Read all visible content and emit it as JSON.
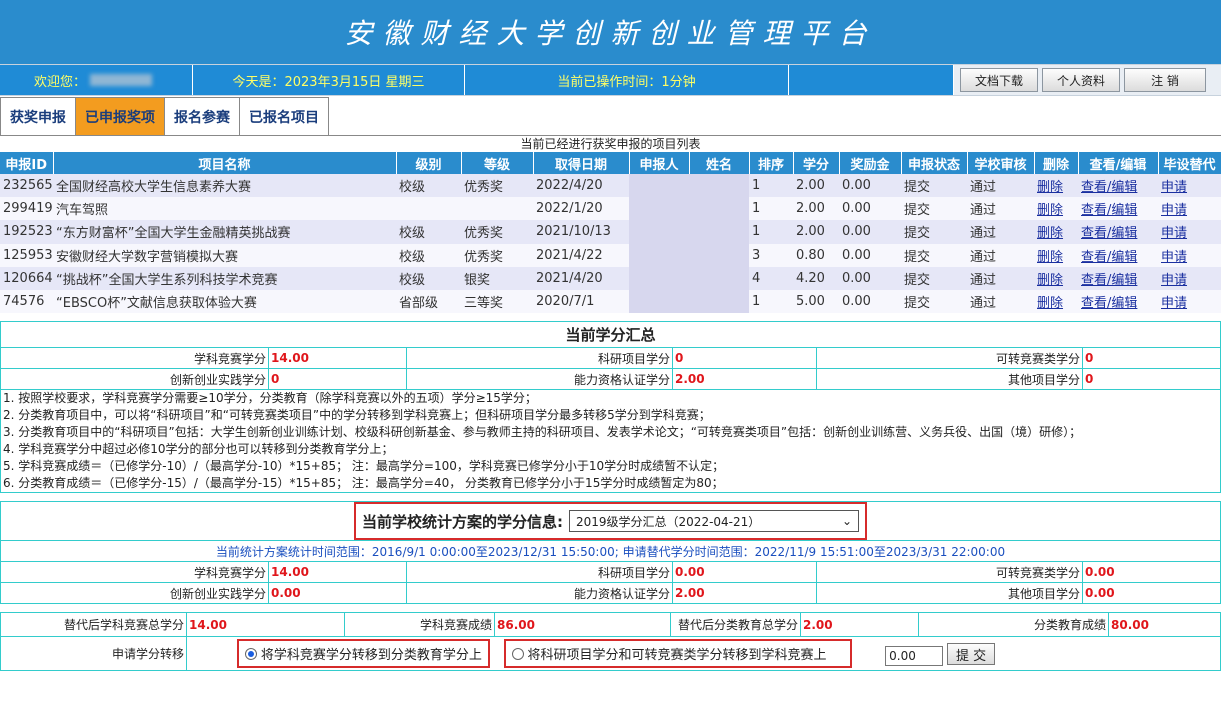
{
  "header": {
    "title": "安徽财经大学创新创业管理平台"
  },
  "infobar": {
    "welcome": "欢迎您：",
    "today": "今天是：2023年3月15日 星期三",
    "elapsed": "当前已操作时间：1分钟",
    "buttons": {
      "download": "文档下载",
      "profile": "个人资料",
      "logout": "注 销"
    }
  },
  "tabs": [
    "获奖申报",
    "已申报奖项",
    "报名参赛",
    "已报名项目"
  ],
  "award_table": {
    "caption": "当前已经进行获奖申报的项目列表",
    "headers": [
      "申报ID",
      "项目名称",
      "级别",
      "等级",
      "取得日期",
      "申报人",
      "姓名",
      "排序",
      "学分",
      "奖励金",
      "申报状态",
      "学校审核",
      "删除",
      "查看/编辑",
      "毕设替代"
    ],
    "rows": [
      [
        "232565",
        "全国财经高校大学生信息素养大赛",
        "校级",
        "优秀奖",
        "2022/4/20",
        "1",
        "2.00",
        "0.00",
        "提交",
        "通过",
        "删除",
        "查看/编辑",
        "申请"
      ],
      [
        "299419",
        "汽车驾照",
        "",
        "",
        "2022/1/20",
        "1",
        "2.00",
        "0.00",
        "提交",
        "通过",
        "删除",
        "查看/编辑",
        "申请"
      ],
      [
        "192523",
        "“东方财富杯”全国大学生金融精英挑战赛",
        "校级",
        "优秀奖",
        "2021/10/13",
        "1",
        "2.00",
        "0.00",
        "提交",
        "通过",
        "删除",
        "查看/编辑",
        "申请"
      ],
      [
        "125953",
        "安徽财经大学数字营销模拟大赛",
        "校级",
        "优秀奖",
        "2021/4/22",
        "3",
        "0.80",
        "0.00",
        "提交",
        "通过",
        "删除",
        "查看/编辑",
        "申请"
      ],
      [
        "120664",
        "“挑战杯”全国大学生系列科技学术竞赛",
        "校级",
        "银奖",
        "2021/4/20",
        "4",
        "4.20",
        "0.00",
        "提交",
        "通过",
        "删除",
        "查看/编辑",
        "申请"
      ],
      [
        "74576",
        "“EBSCO杯”文献信息获取体验大赛",
        "省部级",
        "三等奖",
        "2020/7/1",
        "1",
        "5.00",
        "0.00",
        "提交",
        "通过",
        "删除",
        "查看/编辑",
        "申请"
      ]
    ]
  },
  "summary": {
    "title": "当前学分汇总",
    "competition_label": "学科竞赛学分",
    "competition_value": "14.00",
    "research_label": "科研项目学分",
    "research_value": "0",
    "transferable_label": "可转竞赛类学分",
    "transferable_value": "0",
    "innovation_label": "创新创业实践学分",
    "innovation_value": "0",
    "cert_label": "能力资格认证学分",
    "cert_value": "2.00",
    "other_label": "其他项目学分",
    "other_value": "0",
    "notes": [
      "1. 按照学校要求，学科竞赛学分需要≥10学分，分类教育（除学科竞赛以外的五项）学分≥15学分；",
      "2. 分类教育项目中，可以将“科研项目”和“可转竞赛类项目”中的学分转移到学科竞赛上；但科研项目学分最多转移5学分到学科竞赛；",
      "3. 分类教育项目中的“科研项目”包括：大学生创新创业训练计划、校级科研创新基金、参与教师主持的科研项目、发表学术论文；“可转竞赛类项目”包括：创新创业训练营、义务兵役、出国（境）研修）；",
      "4. 学科竞赛学分中超过必修10学分的部分也可以转移到分类教育学分上；",
      "5. 学科竞赛成绩＝（已修学分-10）/（最高学分-10）*15+85； 注：最高学分=100，学科竞赛已修学分小于10学分时成绩暂不认定；",
      "6. 分类教育成绩＝（已修学分-15）/（最高学分-15）*15+85； 注：最高学分=40， 分类教育已修学分小于15学分时成绩暂定为80；"
    ]
  },
  "scheme": {
    "label": "当前学校统计方案的学分信息:",
    "selected": "2019级学分汇总（2022-04-21）",
    "time_range": "当前统计方案统计时间范围：2016/9/1 0:00:00至2023/12/31 15:50:00;   申请替代学分时间范围：2022/11/9 15:51:00至2023/3/31 22:00:00",
    "competition_label": "学科竞赛学分",
    "competition_value": "14.00",
    "research_label": "科研项目学分",
    "research_value": "0.00",
    "transferable_label": "可转竞赛类学分",
    "transferable_value": "0.00",
    "innovation_label": "创新创业实践学分",
    "innovation_value": "0.00",
    "cert_label": "能力资格认证学分",
    "cert_value": "2.00",
    "other_label": "其他项目学分",
    "other_value": "0.00"
  },
  "bottom": {
    "sub_comp_total_label": "替代后学科竞赛总学分",
    "sub_comp_total_value": "14.00",
    "comp_score_label": "学科竞赛成绩",
    "comp_score_value": "86.00",
    "sub_class_total_label": "替代后分类教育总学分",
    "sub_class_total_value": "2.00",
    "class_score_label": "分类教育成绩",
    "class_score_value": "80.00",
    "transfer_label": "申请学分转移",
    "option1": "将学科竞赛学分转移到分类教育学分上",
    "option2": "将科研项目学分和可转竞赛类学分转移到学科竞赛上",
    "amount": "0.00",
    "submit": "提 交"
  }
}
